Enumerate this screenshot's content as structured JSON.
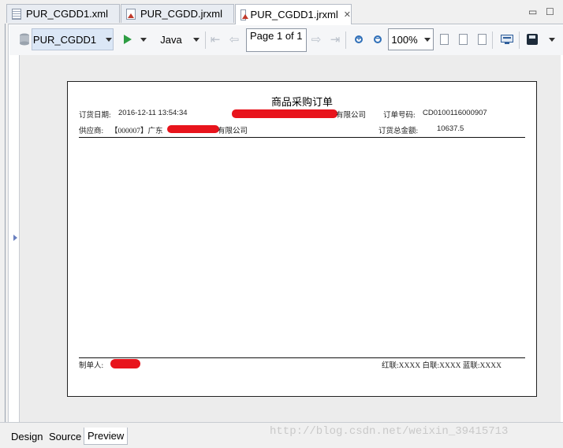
{
  "tabs": [
    {
      "label": "PUR_CGDD1.xml",
      "icon": "grid-file-icon"
    },
    {
      "label": "PUR_CGDD.jrxml",
      "icon": "report-file-icon"
    },
    {
      "label": "PUR_CGDD1.jrxml",
      "icon": "report-file-icon",
      "active": true
    }
  ],
  "toolbar": {
    "datasource": "PUR_CGDD1",
    "language": "Java",
    "page_indicator": "Page 1 of 1",
    "zoom": "100%"
  },
  "report": {
    "title": "商品采购订单",
    "order_date_label": "订货日期:",
    "order_date_value": "2016-12-11 13:54:34",
    "company_suffix": "有限公司",
    "order_no_label": "订单号码:",
    "order_no_value": "CD0100116000907",
    "supplier_label": "供应商:",
    "supplier_value_prefix": "【000007】广东",
    "supplier_value_suffix": "有限公司",
    "total_label": "订货总金额:",
    "total_value": "10637.5",
    "maker_label": "制单人:",
    "copies": "红联:XXXX  白联:XXXX  蓝联:XXXX"
  },
  "bottom_tabs": [
    {
      "label": "Design"
    },
    {
      "label": "Source"
    },
    {
      "label": "Preview",
      "active": true
    }
  ],
  "watermark": "http://blog.csdn.net/weixin_39415713",
  "colors": {
    "accent": "#dbe7f6",
    "redaction": "#e8141c",
    "run": "#2e9d43"
  }
}
